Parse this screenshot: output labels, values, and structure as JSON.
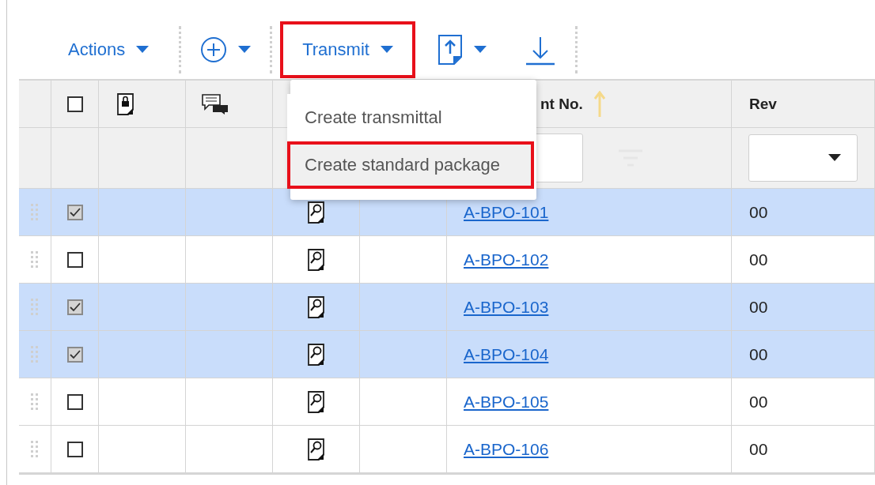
{
  "toolbar": {
    "actions_label": "Actions",
    "transmit": {
      "label": "Transmit",
      "highlighted": true
    }
  },
  "transmit_menu": {
    "items": [
      {
        "label": "Create transmittal",
        "highlighted": false
      },
      {
        "label": "Create standard package",
        "highlighted": true
      }
    ]
  },
  "table": {
    "header_checked": false,
    "columns": {
      "document_no": "nt No.",
      "rev": "Rev"
    },
    "rows": [
      {
        "doc_no": "A-BPO-101",
        "rev": "00",
        "selected": true
      },
      {
        "doc_no": "A-BPO-102",
        "rev": "00",
        "selected": false
      },
      {
        "doc_no": "A-BPO-103",
        "rev": "00",
        "selected": true
      },
      {
        "doc_no": "A-BPO-104",
        "rev": "00",
        "selected": true
      },
      {
        "doc_no": "A-BPO-105",
        "rev": "00",
        "selected": false
      },
      {
        "doc_no": "A-BPO-106",
        "rev": "00",
        "selected": false
      }
    ]
  }
}
